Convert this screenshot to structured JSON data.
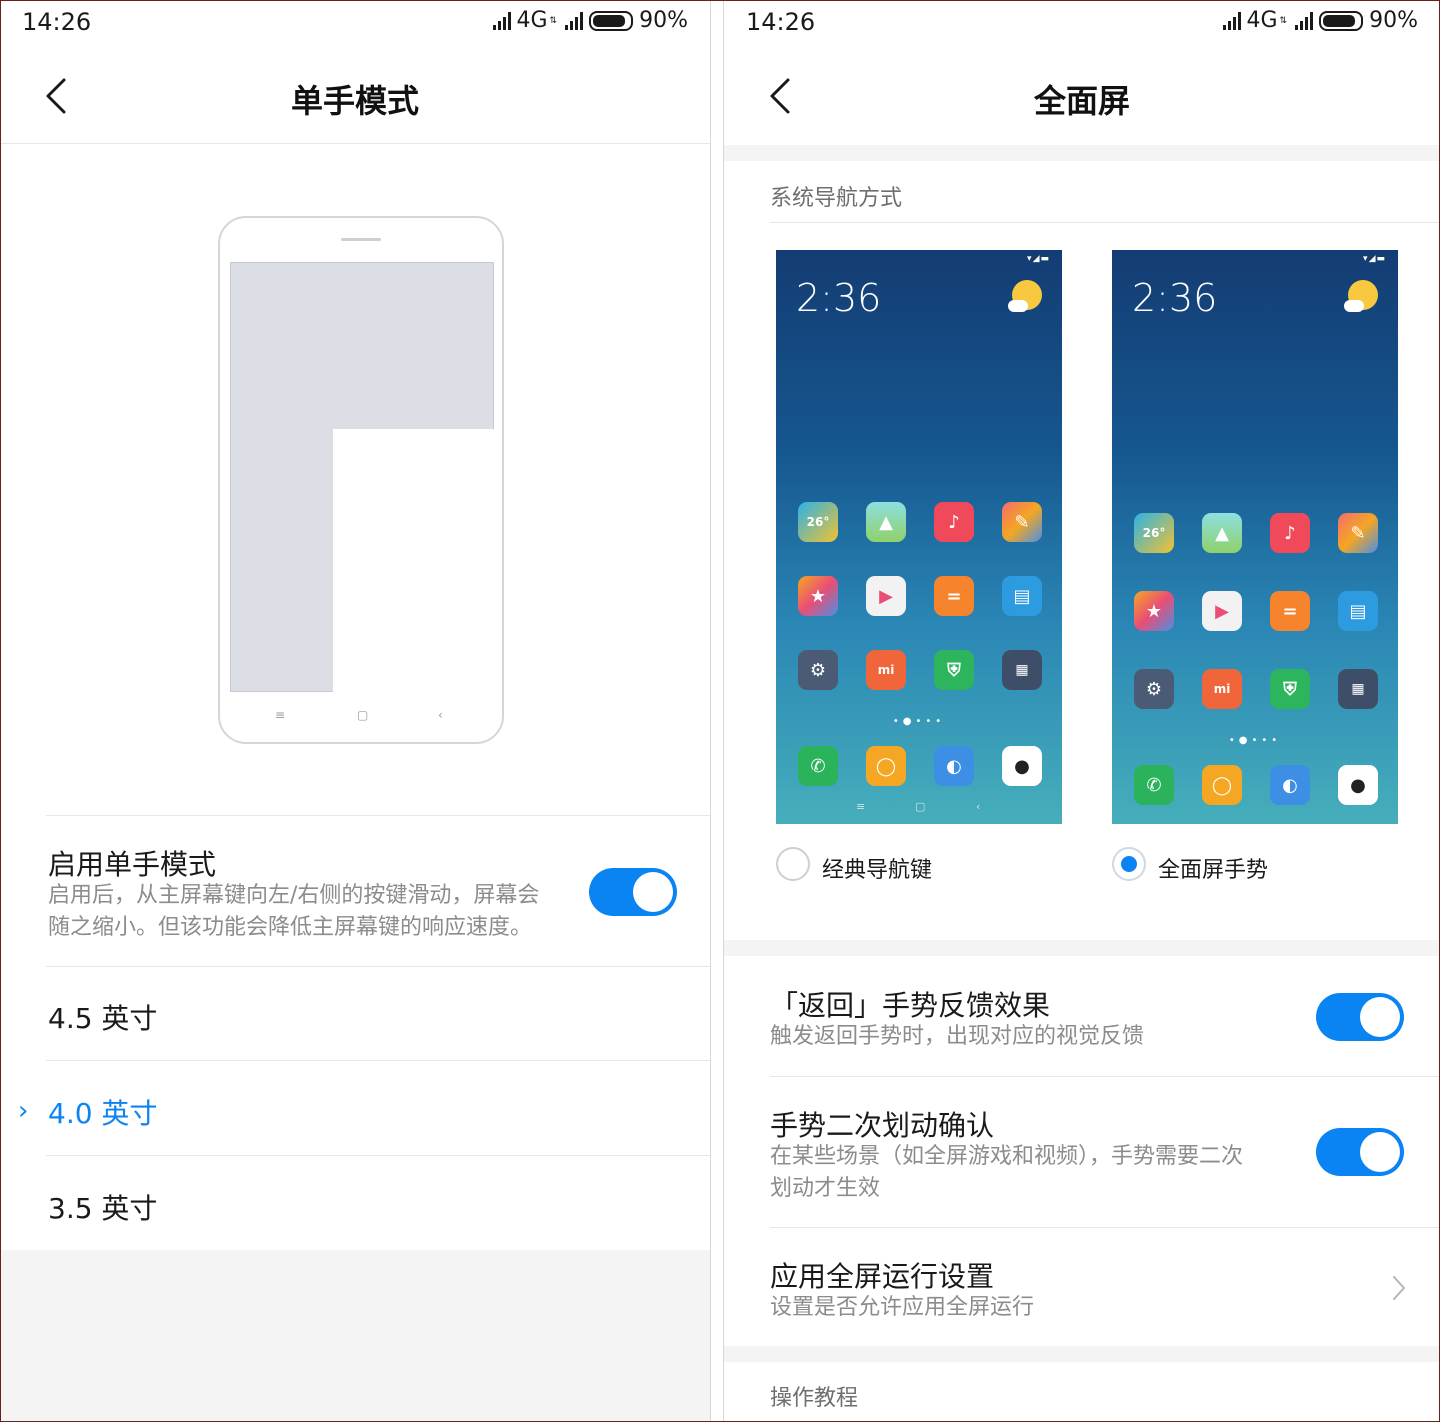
{
  "status_bar": {
    "time": "14:26",
    "network": "4G",
    "network_sub": "⇅",
    "battery": "90%",
    "battery_level": 0.9
  },
  "left": {
    "title": "单手模式",
    "enable": {
      "title": "启用单手模式",
      "desc_line1": "启用后，从主屏幕键向左/右侧的按键滑动，屏幕会",
      "desc_line2": "随之缩小。但该功能会降低主屏幕键的响应速度。",
      "enabled": true
    },
    "sizes": [
      {
        "label": "4.5 英寸",
        "selected": false
      },
      {
        "label": "4.0 英寸",
        "selected": true
      },
      {
        "label": "3.5 英寸",
        "selected": false
      }
    ]
  },
  "right": {
    "title": "全面屏",
    "nav_section_label": "系统导航方式",
    "preview_clock": "2:36",
    "preview_weather_temp": "26°",
    "options": [
      {
        "label": "经典导航键",
        "selected": false
      },
      {
        "label": "全面屏手势",
        "selected": true
      }
    ],
    "settings": [
      {
        "title": "「返回」手势反馈效果",
        "desc": "触发返回手势时，出现对应的视觉反馈",
        "enabled": true
      },
      {
        "title": "手势二次划动确认",
        "desc_line1": "在某些场景（如全屏游戏和视频），手势需要二次",
        "desc_line2": "划动才生效",
        "enabled": true
      },
      {
        "title": "应用全屏运行设置",
        "desc": "设置是否允许应用全屏运行"
      }
    ],
    "tutorial_label": "操作教程"
  },
  "colors": {
    "accent": "#0b84f3",
    "text_primary": "#1a1a1a",
    "text_secondary": "#8c8c8c",
    "section_bg": "#f4f4f4"
  }
}
